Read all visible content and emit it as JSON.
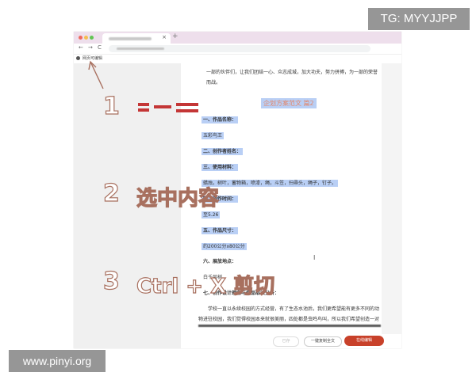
{
  "watermarks": {
    "top_right": "TG: MYYJJPP",
    "bottom_left": "www.pinyi.org"
  },
  "browser": {
    "bookmark_label": "网页可编辑",
    "tab_close": "×",
    "new_tab": "+",
    "nav_back": "←",
    "nav_forward": "→",
    "nav_reload": "C"
  },
  "document": {
    "intro_line1": "一部的伙伴们，让我们团结一心、众志成城，加大功夫，努力拼搏，为一部的荣誉",
    "intro_line2": "而战。",
    "title": "企划方案范文 篇2",
    "items": [
      "一、作品名称：",
      "五彩鸟王",
      "二、创作者姓名：",
      "三、使用材料：",
      "蜡烛，树叶，蓄物箱，喷漆，绳，斗笠，扫帚头，绳子，钉子。",
      "四、创作时间：",
      "至5.26",
      "五、作品尺寸：",
      "约200公分x80公分",
      "六、展放地点：",
      "白千层树",
      "七、创作设计理念与作品取法分析：",
      "学校一直以永续校园的方式经营，有了生态水池后，我们更希望能有更多不同的动",
      "物进驻校园，我们觉得校园本来就很美丽，四处都是虫鸣鸟叫，所以我们希望创造一对"
    ]
  },
  "bottom_actions": {
    "disabled_label": "已存",
    "copy_label": "一键复制全文",
    "primary_label": "在线编辑"
  },
  "steps": [
    {
      "num": "1",
      "text": ""
    },
    {
      "num": "2",
      "text": "选中内容"
    },
    {
      "num": "3",
      "text": "Ctrl + X 剪切"
    }
  ],
  "colors": {
    "selection": "#b9cff5",
    "title_text": "#e2876c",
    "primary_button": "#c8412a",
    "step_outline": "#a8705f",
    "redaction": "#c43636"
  },
  "icons": [
    "ibeam-cursor-icon",
    "arrow-annotation-icon",
    "bookmark-icon"
  ]
}
